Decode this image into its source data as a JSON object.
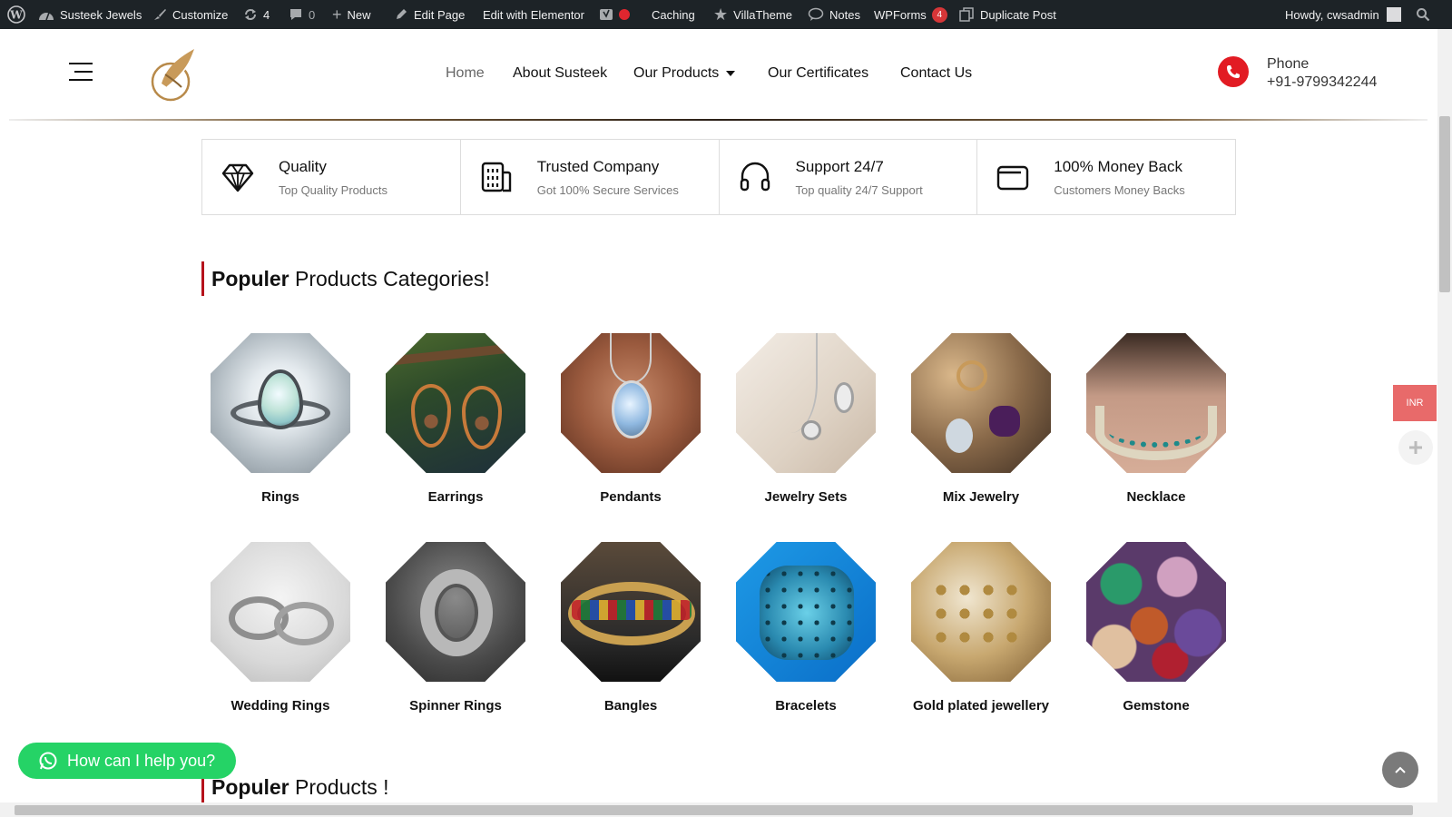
{
  "admin_bar": {
    "site_name": "Susteek Jewels",
    "customize": "Customize",
    "updates": "4",
    "comments": "0",
    "new": "New",
    "edit_page": "Edit Page",
    "edit_elementor": "Edit with Elementor",
    "caching": "Caching",
    "villatheme": "VillaTheme",
    "notes": "Notes",
    "wpforms": "WPForms",
    "wpforms_count": "4",
    "duplicate": "Duplicate Post",
    "howdy": "Howdy, cwsadmin"
  },
  "nav": {
    "home": "Home",
    "about": "About Susteek",
    "products": "Our Products",
    "certificates": "Our Certificates",
    "contact": "Contact Us"
  },
  "phone": {
    "label": "Phone",
    "number": "+91-9799342244"
  },
  "features": [
    {
      "title": "Quality",
      "subtitle": "Top Quality Products",
      "icon": "diamond-icon"
    },
    {
      "title": "Trusted Company",
      "subtitle": "Got 100% Secure Services",
      "icon": "building-icon"
    },
    {
      "title": "Support 24/7",
      "subtitle": "Top quality 24/7 Support",
      "icon": "headphones-icon"
    },
    {
      "title": "100% Money Back",
      "subtitle": "Customers Money Backs",
      "icon": "wallet-icon"
    }
  ],
  "section1": {
    "bold": "Populer",
    "rest": " Products Categories!"
  },
  "section2": {
    "bold": "Populer",
    "rest": " Products !"
  },
  "categories": [
    {
      "label": "Rings"
    },
    {
      "label": "Earrings"
    },
    {
      "label": "Pendants"
    },
    {
      "label": "Jewelry Sets"
    },
    {
      "label": "Mix Jewelry"
    },
    {
      "label": "Necklace"
    },
    {
      "label": "Wedding Rings"
    },
    {
      "label": "Spinner Rings"
    },
    {
      "label": "Bangles"
    },
    {
      "label": "Bracelets"
    },
    {
      "label": "Gold plated jewellery"
    },
    {
      "label": "Gemstone"
    }
  ],
  "currency": "INR",
  "whatsapp": "How can I help you?",
  "colors": {
    "accent_red": "#b5121b",
    "whatsapp_green": "#25d366",
    "admin_bar": "#1d2327"
  }
}
